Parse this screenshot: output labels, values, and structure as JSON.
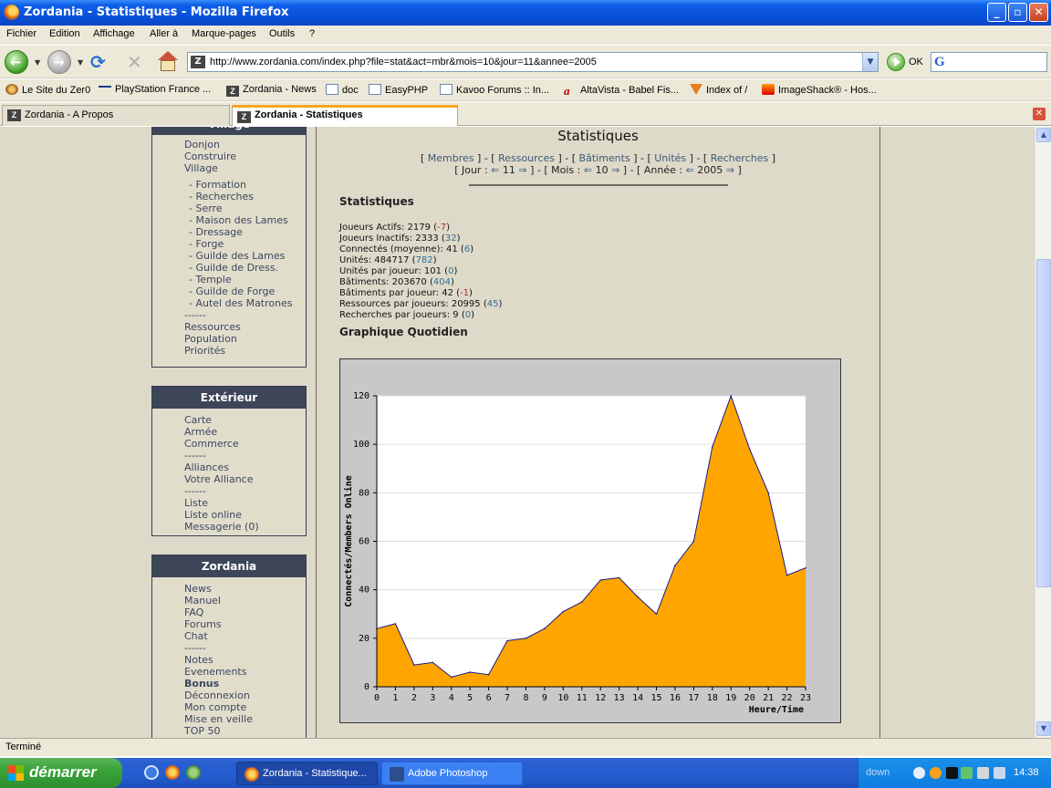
{
  "window": {
    "title": "Zordania - Statistiques - Mozilla Firefox"
  },
  "menubar": [
    "Fichier",
    "Edition",
    "Affichage",
    "Aller à",
    "Marque-pages",
    "Outils",
    "?"
  ],
  "navbar": {
    "url": "http://www.zordania.com/index.php?file=stat&act=mbr&mois=10&jour=11&annee=2005",
    "go_label": "OK"
  },
  "bookmarks": [
    "Le Site du Zer0",
    "PlayStation France ...",
    "Zordania - News",
    "doc",
    "EasyPHP",
    "Kavoo Forums :: In...",
    "AltaVista - Babel Fis...",
    "Index of /",
    "ImageShack® - Hos..."
  ],
  "tabs": [
    "Zordania - A Propos",
    "Zordania - Statistiques"
  ],
  "sidebar": {
    "village": {
      "title": "Village",
      "items": [
        "Donjon",
        "Construire",
        "Village"
      ],
      "subitems": [
        "- Formation",
        "- Recherches",
        "- Serre",
        "- Maison des Lames",
        "- Dressage",
        "- Forge",
        "- Guilde des Lames",
        "- Guilde de Dress.",
        "- Temple",
        "- Guilde de Forge",
        "- Autel des Matrones"
      ],
      "sep": "------",
      "items2": [
        "Ressources",
        "Population",
        "Priorités"
      ]
    },
    "exterieur": {
      "title": "Extérieur",
      "items": [
        "Carte",
        "Armée",
        "Commerce",
        "------",
        "Alliances",
        "Votre Alliance",
        "------",
        "Liste",
        "Liste online",
        "Messagerie (0)"
      ]
    },
    "zordania": {
      "title": "Zordania",
      "items": [
        "News",
        "Manuel",
        "FAQ",
        "Forums",
        "Chat",
        "------",
        "Notes",
        "Evenements",
        "Bonus",
        "Déconnexion",
        "Mon compte",
        "Mise en veille",
        "TOP 50"
      ]
    }
  },
  "main": {
    "title": "Statistiques",
    "nav1": {
      "links": [
        "Membres",
        "Ressources",
        "Bâtiments",
        "Unités",
        "Recherches"
      ]
    },
    "nav2": {
      "jour_label": "Jour :",
      "jour": "11",
      "mois_label": "Mois :",
      "mois": "10",
      "annee_label": "Année :",
      "annee": "2005"
    },
    "stats_heading": "Statistiques",
    "stats": [
      {
        "label": "Joueurs Actifs:",
        "value": "2179",
        "delta": "-7",
        "neg": true
      },
      {
        "label": "Joueurs Inactifs:",
        "value": "2333",
        "delta": "32",
        "neg": false
      },
      {
        "label": "Connectés (moyenne):",
        "value": "41",
        "delta": "6",
        "neg": false
      },
      {
        "label": "Unités:",
        "value": "484717",
        "delta": "782",
        "neg": false
      },
      {
        "label": "Unités par joueur:",
        "value": "101",
        "delta": "0",
        "neg": false
      },
      {
        "label": "Bâtiments:",
        "value": "203670",
        "delta": "404",
        "neg": false
      },
      {
        "label": "Bâtiments par joueur:",
        "value": "42",
        "delta": "-1",
        "neg": true
      },
      {
        "label": "Ressources par joueurs:",
        "value": "20995",
        "delta": "45",
        "neg": false
      },
      {
        "label": "Recherches par joueurs:",
        "value": "9",
        "delta": "0",
        "neg": false
      }
    ],
    "graph_heading": "Graphique Quotidien"
  },
  "chart_data": {
    "type": "area",
    "x": [
      0,
      1,
      2,
      3,
      4,
      5,
      6,
      7,
      8,
      9,
      10,
      11,
      12,
      13,
      14,
      15,
      16,
      17,
      18,
      19,
      20,
      21,
      22,
      23
    ],
    "series": [
      {
        "values": [
          24,
          26,
          9,
          10,
          4,
          6,
          5,
          19,
          20,
          24,
          31,
          35,
          44,
          45,
          37,
          30,
          50,
          60,
          99,
          120,
          98,
          80,
          46,
          49
        ]
      }
    ],
    "xlabel": "Heure/Time",
    "ylabel": "Connectés/Members Online",
    "ylim": [
      0,
      120
    ],
    "yticks": [
      0,
      20,
      40,
      60,
      80,
      100,
      120
    ],
    "grid": true,
    "fill_color": "#ffa500",
    "line_color": "#1a1a8c"
  },
  "statusbar": {
    "text": "Terminé"
  },
  "taskbar": {
    "start_label": "démarrer",
    "tasks": [
      "Zordania - Statistique...",
      "Adobe Photoshop"
    ],
    "tray_label": "down",
    "clock": "14:38"
  }
}
